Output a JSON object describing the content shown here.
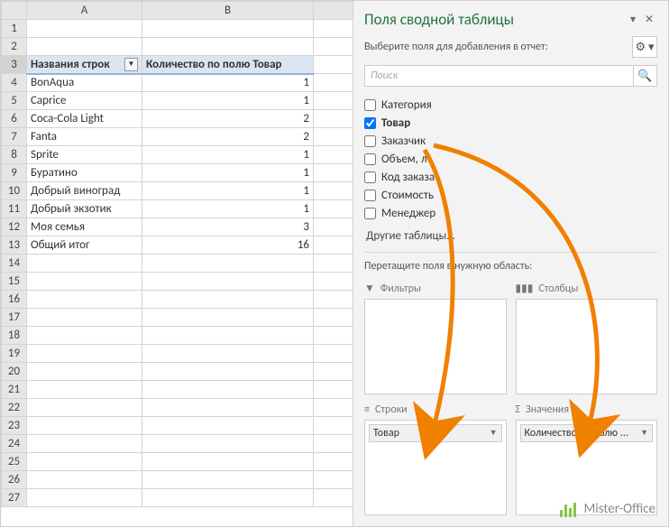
{
  "sheet": {
    "columns": [
      "A",
      "B",
      ""
    ],
    "header_row": 3,
    "headers": {
      "A": "Названия строк",
      "B": "Количество по полю Товар"
    },
    "rows": [
      {
        "r": 4,
        "label": "BonAqua",
        "value": 1
      },
      {
        "r": 5,
        "label": "Caprice",
        "value": 1
      },
      {
        "r": 6,
        "label": "Coca-Cola Light",
        "value": 2
      },
      {
        "r": 7,
        "label": "Fanta",
        "value": 2
      },
      {
        "r": 8,
        "label": "Sprite",
        "value": 1
      },
      {
        "r": 9,
        "label": "Буратино",
        "value": 1
      },
      {
        "r": 10,
        "label": "Добрый виноград",
        "value": 1
      },
      {
        "r": 11,
        "label": "Добрый экзотик",
        "value": 1
      },
      {
        "r": 12,
        "label": "Моя семья",
        "value": 3
      }
    ],
    "total": {
      "r": 13,
      "label": "Общий итог",
      "value": 16
    },
    "total_rows": 27
  },
  "pane": {
    "title": "Поля сводной таблицы",
    "subtitle": "Выберите поля для добавления в отчет:",
    "search_placeholder": "Поиск",
    "fields": [
      {
        "name": "Категория",
        "checked": false
      },
      {
        "name": "Товар",
        "checked": true
      },
      {
        "name": "Заказчик",
        "checked": false
      },
      {
        "name": "Объем, л",
        "checked": false
      },
      {
        "name": "Код заказа",
        "checked": false
      },
      {
        "name": "Стоимость",
        "checked": false
      },
      {
        "name": "Менеджер",
        "checked": false
      }
    ],
    "other_tables": "Другие таблицы...",
    "drag_hint": "Перетащите поля в нужную область:",
    "areas": {
      "filters": {
        "label": "Фильтры",
        "items": []
      },
      "columns": {
        "label": "Столбцы",
        "items": []
      },
      "rows": {
        "label": "Строки",
        "items": [
          "Товар"
        ]
      },
      "values": {
        "label": "Значения",
        "items": [
          "Количество по полю ..."
        ]
      }
    }
  },
  "watermark": "Mister-Office"
}
